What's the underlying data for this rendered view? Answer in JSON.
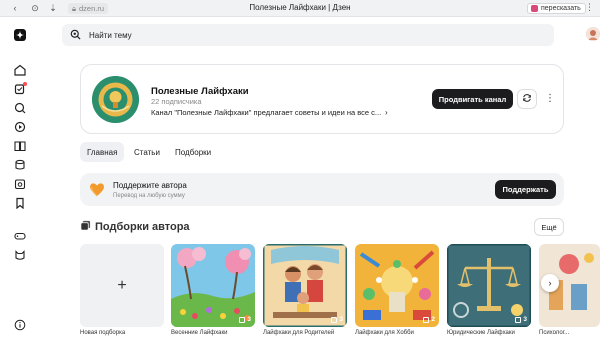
{
  "browser": {
    "address": "dzen.ru",
    "tab_title": "Полезные Лайфхаки | Дзен",
    "retell_label": "пересказать"
  },
  "search": {
    "placeholder": "Найти тему"
  },
  "channel": {
    "name": "Полезные Лайфхаки",
    "subscribers": "22 подписчика",
    "description": "Канал \"Полезные Лайфхаки\" предлагает советы и идеи на все с...",
    "description_arrow": "›",
    "promote_label": "Продвигать канал",
    "more_label": "⋮"
  },
  "tabs": [
    {
      "label": "Главная",
      "active": true
    },
    {
      "label": "Статьи",
      "active": false
    },
    {
      "label": "Подборки",
      "active": false
    }
  ],
  "support": {
    "title": "Поддержите автора",
    "subtitle": "Перевод на любую сумму",
    "button": "Поддержать"
  },
  "collections_section": {
    "title": "Подборки автора",
    "all_label": "Ещё",
    "new_label": "Новая подборка",
    "new_symbol": "+",
    "items": [
      {
        "label": "Весенние Лайфхаки",
        "count": "3"
      },
      {
        "label": "Лайфхаки для Родителей",
        "count": "3"
      },
      {
        "label": "Лайфхаки для Хобби",
        "count": "2"
      },
      {
        "label": "Юридические Лайфхаки",
        "count": "3"
      },
      {
        "label": "Психолог...",
        "count": ""
      }
    ],
    "next_symbol": "›"
  },
  "colors": {
    "accent_dark": "#1c1c1e",
    "notification": "#ff4d4f",
    "panel_bg": "#f2f3f5"
  }
}
